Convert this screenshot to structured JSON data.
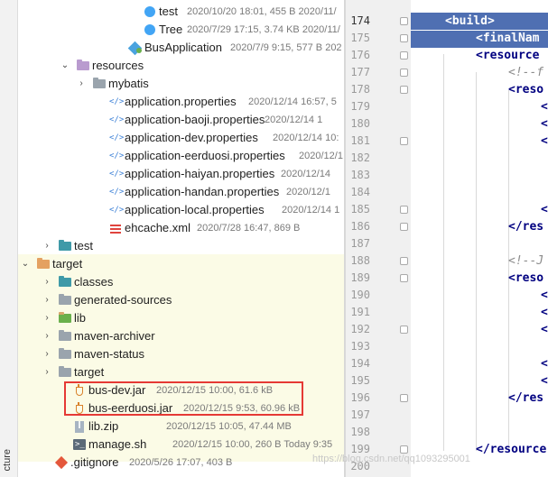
{
  "side_strip": {
    "label": "cture"
  },
  "tree": [
    {
      "label": "test",
      "meta": "2020/10/20 18:01, 455 B 2020/11/",
      "icon": "class-icon",
      "arrow": ""
    },
    {
      "label": "Tree",
      "meta": "2020/7/29 17:15, 3.74 KB 2020/11/",
      "icon": "class-icon",
      "arrow": ""
    },
    {
      "label": "BusApplication",
      "meta": "2020/7/9 9:15, 577 B 202",
      "icon": "spring-boot-class-icon",
      "arrow": ""
    },
    {
      "label": "resources",
      "meta": "",
      "icon": "resources-folder-icon",
      "arrow": "expanded"
    },
    {
      "label": "mybatis",
      "meta": "",
      "icon": "folder-icon",
      "arrow": "collapsed"
    },
    {
      "label": "application.properties",
      "meta": "2020/12/14 16:57, 5",
      "icon": "properties-file-icon",
      "arrow": ""
    },
    {
      "label": "application-baoji.properties",
      "meta": "2020/12/14 1",
      "icon": "properties-file-icon",
      "arrow": ""
    },
    {
      "label": "application-dev.properties",
      "meta": "2020/12/14 10:",
      "icon": "properties-file-icon",
      "arrow": ""
    },
    {
      "label": "application-eerduosi.properties",
      "meta": "2020/12/1",
      "icon": "properties-file-icon",
      "arrow": ""
    },
    {
      "label": "application-haiyan.properties",
      "meta": "2020/12/14",
      "icon": "properties-file-icon",
      "arrow": ""
    },
    {
      "label": "application-handan.properties",
      "meta": "2020/12/1",
      "icon": "properties-file-icon",
      "arrow": ""
    },
    {
      "label": "application-local.properties",
      "meta": "2020/12/14 1",
      "icon": "properties-file-icon",
      "arrow": ""
    },
    {
      "label": "ehcache.xml",
      "meta": "2020/7/28 16:47, 869 B",
      "icon": "xml-file-icon",
      "arrow": ""
    },
    {
      "label": "test",
      "meta": "",
      "icon": "test-folder-icon",
      "arrow": "collapsed"
    },
    {
      "label": "target",
      "meta": "",
      "icon": "target-folder-icon",
      "arrow": "expanded"
    },
    {
      "label": "classes",
      "meta": "",
      "icon": "classes-folder-icon",
      "arrow": "collapsed"
    },
    {
      "label": "generated-sources",
      "meta": "",
      "icon": "folder-icon",
      "arrow": "collapsed"
    },
    {
      "label": "lib",
      "meta": "",
      "icon": "library-folder-icon",
      "arrow": "collapsed"
    },
    {
      "label": "maven-archiver",
      "meta": "",
      "icon": "folder-icon",
      "arrow": "collapsed"
    },
    {
      "label": "maven-status",
      "meta": "",
      "icon": "folder-icon",
      "arrow": "collapsed"
    },
    {
      "label": "target",
      "meta": "",
      "icon": "folder-icon",
      "arrow": "collapsed"
    },
    {
      "label": "bus-dev.jar",
      "meta": "2020/12/15 10:00, 61.6 kB",
      "icon": "jar-file-icon",
      "arrow": ""
    },
    {
      "label": "bus-eerduosi.jar",
      "meta": "2020/12/15 9:53, 60.96 kB",
      "icon": "jar-file-icon",
      "arrow": ""
    },
    {
      "label": "lib.zip",
      "meta": "2020/12/15 10:05, 47.44 MB",
      "icon": "zip-file-icon",
      "arrow": ""
    },
    {
      "label": "manage.sh",
      "meta": "2020/12/15 10:00, 260 B Today 9:35",
      "icon": "shell-script-icon",
      "arrow": ""
    },
    {
      "label": ".gitignore",
      "meta": "2020/5/26 17:07, 403 B",
      "icon": "gitignore-file-icon",
      "arrow": ""
    }
  ],
  "editor": {
    "line_numbers": [
      "174",
      "175",
      "176",
      "177",
      "178",
      "179",
      "180",
      "181",
      "182",
      "183",
      "184",
      "185",
      "186",
      "187",
      "188",
      "189",
      "190",
      "191",
      "192",
      "193",
      "194",
      "195",
      "196",
      "197",
      "198",
      "199",
      "200"
    ],
    "lines": [
      {
        "text": "<build>",
        "kind": "tag"
      },
      {
        "text": "<finalNam",
        "kind": "tag"
      },
      {
        "text": "<resource",
        "kind": "tag"
      },
      {
        "text": "<!--f",
        "kind": "comment"
      },
      {
        "text": "<reso",
        "kind": "tag"
      },
      {
        "text": "<",
        "kind": "tag"
      },
      {
        "text": "<",
        "kind": "tag"
      },
      {
        "text": "<",
        "kind": "tag"
      },
      {
        "text": "",
        "kind": "tag"
      },
      {
        "text": "",
        "kind": "tag"
      },
      {
        "text": "",
        "kind": "tag"
      },
      {
        "text": "<",
        "kind": "tag"
      },
      {
        "text": "</res",
        "kind": "tag"
      },
      {
        "text": "",
        "kind": "tag"
      },
      {
        "text": "<!--J",
        "kind": "comment"
      },
      {
        "text": "<reso",
        "kind": "tag"
      },
      {
        "text": "<",
        "kind": "tag"
      },
      {
        "text": "<",
        "kind": "tag"
      },
      {
        "text": "<",
        "kind": "tag"
      },
      {
        "text": "",
        "kind": "tag"
      },
      {
        "text": "<",
        "kind": "tag"
      },
      {
        "text": "<",
        "kind": "tag"
      },
      {
        "text": "</res",
        "kind": "tag"
      },
      {
        "text": "",
        "kind": "tag"
      },
      {
        "text": "",
        "kind": "tag"
      },
      {
        "text": "</resource",
        "kind": "tag"
      },
      {
        "text": "",
        "kind": "tag"
      }
    ]
  },
  "watermark": "https://blog.csdn.net/qq1093295001"
}
